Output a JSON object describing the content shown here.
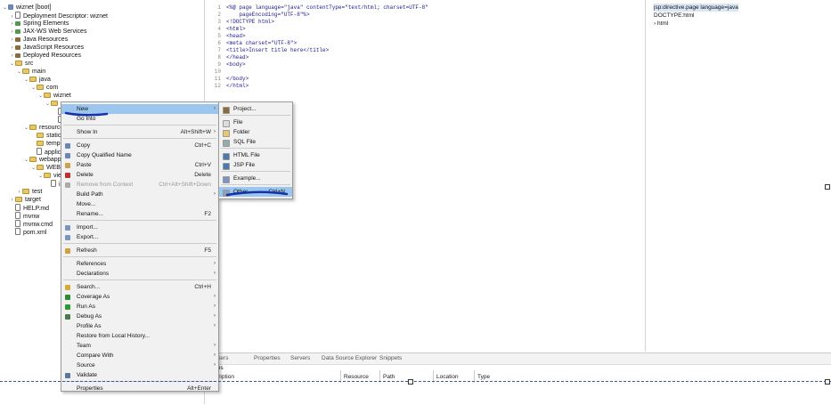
{
  "explorer": {
    "items": [
      {
        "label": "wiznet [boot]",
        "icon": "project-icon",
        "kind": "proj",
        "tw": "v"
      },
      {
        "label": "Deployment Descriptor: wiznet",
        "icon": "descriptor-icon",
        "kind": "file",
        "tw": ">"
      },
      {
        "label": "Spring Elements",
        "icon": "spring-icon",
        "kind": "ws",
        "tw": ">"
      },
      {
        "label": "JAX-WS Web Services",
        "icon": "webservice-icon",
        "kind": "ws",
        "tw": ">"
      },
      {
        "label": "Java Resources",
        "icon": "java-resources-icon",
        "kind": "lib",
        "tw": ">"
      },
      {
        "label": "JavaScript Resources",
        "icon": "javascript-resources-icon",
        "kind": "lib",
        "tw": ">"
      },
      {
        "label": "Deployed Resources",
        "icon": "deployed-resources-icon",
        "kind": "lib",
        "tw": ">"
      },
      {
        "label": "src",
        "icon": "folder-icon",
        "kind": "folder",
        "tw": "v"
      },
      {
        "label": "main",
        "icon": "folder-icon",
        "kind": "folder",
        "tw": "v"
      },
      {
        "label": "java",
        "icon": "folder-icon",
        "kind": "folder",
        "tw": "v"
      },
      {
        "label": "com",
        "icon": "folder-icon",
        "kind": "folder",
        "tw": "v"
      },
      {
        "label": "wiznet",
        "icon": "folder-icon",
        "kind": "folder",
        "tw": "v"
      },
      {
        "label": "w",
        "icon": "folder-icon",
        "kind": "folder",
        "tw": "v"
      },
      {
        "label": "",
        "icon": "file-icon",
        "kind": "file",
        "tw": ""
      },
      {
        "label": "",
        "icon": "file-icon",
        "kind": "file",
        "tw": ""
      },
      {
        "label": "resources",
        "icon": "folder-icon",
        "kind": "folder",
        "tw": "v"
      },
      {
        "label": "static",
        "icon": "folder-icon",
        "kind": "folder",
        "tw": ""
      },
      {
        "label": "templat",
        "icon": "folder-icon",
        "kind": "folder",
        "tw": ""
      },
      {
        "label": "applicat",
        "icon": "file-icon",
        "kind": "file",
        "tw": ""
      },
      {
        "label": "webapp",
        "icon": "folder-icon",
        "kind": "folder",
        "tw": "v"
      },
      {
        "label": "WEB-IN",
        "icon": "folder-icon",
        "kind": "folder",
        "tw": "v"
      },
      {
        "label": "view",
        "icon": "folder-icon",
        "kind": "folder",
        "tw": "v"
      },
      {
        "label": "in",
        "icon": "file-icon",
        "kind": "file",
        "tw": ""
      },
      {
        "label": "test",
        "icon": "folder-icon",
        "kind": "folder",
        "tw": ">"
      },
      {
        "label": "target",
        "icon": "folder-icon",
        "kind": "folder",
        "tw": ">"
      },
      {
        "label": "HELP.md",
        "icon": "file-icon",
        "kind": "file",
        "tw": ""
      },
      {
        "label": "mvnw",
        "icon": "file-icon",
        "kind": "file",
        "tw": ""
      },
      {
        "label": "mvnw.cmd",
        "icon": "file-icon",
        "kind": "file",
        "tw": ""
      },
      {
        "label": "pom.xml",
        "icon": "file-icon",
        "kind": "file",
        "tw": ""
      }
    ]
  },
  "editor": {
    "line_numbers": [
      "1",
      "2",
      "3",
      "4",
      "5",
      "6",
      "7",
      "8",
      "9",
      "10",
      "11",
      "12"
    ],
    "line_markers": [
      "⊖",
      "",
      "",
      "4⊖",
      "5⊖",
      "",
      "",
      "",
      "9⊖",
      "",
      "",
      ""
    ],
    "lines": [
      "<%@ page language=\"java\" contentType=\"text/html; charset=UTF-8\"",
      "    pageEncoding=\"UTF-8\"%>",
      "<!DOCTYPE html>",
      "<html>",
      "<head>",
      "<meta charset=\"UTF-8\">",
      "<title>Insert title here</title>",
      "</head>",
      "<body>",
      "",
      "</body>",
      "</html>"
    ]
  },
  "outline": {
    "items": [
      "jsp:directive.page language=java",
      "DOCTYPE:html",
      "html"
    ]
  },
  "bottom": {
    "tabs": [
      "rkers",
      "Properties",
      "Servers",
      "Data Source Explorer",
      "Snippets"
    ],
    "subtitle": "ms",
    "columns": [
      "cription",
      "Resource",
      "Path",
      "Location",
      "Type"
    ]
  },
  "context_menu": {
    "items": [
      {
        "label": "New",
        "shortcut": "",
        "arrow": true,
        "selected": true,
        "icon": ""
      },
      {
        "label": "Go Into",
        "shortcut": "",
        "arrow": false,
        "icon": ""
      },
      {
        "sep": true
      },
      {
        "label": "Show In",
        "shortcut": "Alt+Shift+W",
        "arrow": true,
        "icon": ""
      },
      {
        "sep": true
      },
      {
        "label": "Copy",
        "shortcut": "Ctrl+C",
        "arrow": false,
        "icon": "copy-icon"
      },
      {
        "label": "Copy Qualified Name",
        "shortcut": "",
        "arrow": false,
        "icon": "copy-qualified-icon"
      },
      {
        "label": "Paste",
        "shortcut": "Ctrl+V",
        "arrow": false,
        "icon": "paste-icon"
      },
      {
        "label": "Delete",
        "shortcut": "Delete",
        "arrow": false,
        "icon": "delete-icon"
      },
      {
        "label": "Remove from Context",
        "shortcut": "Ctrl+Alt+Shift+Down",
        "arrow": false,
        "disabled": true,
        "icon": "remove-context-icon"
      },
      {
        "label": "Build Path",
        "shortcut": "",
        "arrow": true,
        "icon": ""
      },
      {
        "label": "Move...",
        "shortcut": "",
        "arrow": false,
        "icon": ""
      },
      {
        "label": "Rename...",
        "shortcut": "F2",
        "arrow": false,
        "icon": ""
      },
      {
        "sep": true
      },
      {
        "label": "Import...",
        "shortcut": "",
        "arrow": false,
        "icon": "import-icon"
      },
      {
        "label": "Export...",
        "shortcut": "",
        "arrow": false,
        "icon": "export-icon"
      },
      {
        "sep": true
      },
      {
        "label": "Refresh",
        "shortcut": "F5",
        "arrow": false,
        "icon": "refresh-icon"
      },
      {
        "sep": true
      },
      {
        "label": "References",
        "shortcut": "",
        "arrow": true,
        "icon": ""
      },
      {
        "label": "Declarations",
        "shortcut": "",
        "arrow": true,
        "icon": ""
      },
      {
        "sep": true
      },
      {
        "label": "Search...",
        "shortcut": "Ctrl+H",
        "arrow": false,
        "icon": "search-icon"
      },
      {
        "label": "Coverage As",
        "shortcut": "",
        "arrow": true,
        "icon": "coverage-icon"
      },
      {
        "label": "Run As",
        "shortcut": "",
        "arrow": true,
        "icon": "run-icon"
      },
      {
        "label": "Debug As",
        "shortcut": "",
        "arrow": true,
        "icon": "debug-icon"
      },
      {
        "label": "Profile As",
        "shortcut": "",
        "arrow": true,
        "icon": ""
      },
      {
        "label": "Restore from Local History...",
        "shortcut": "",
        "arrow": false,
        "icon": ""
      },
      {
        "label": "Team",
        "shortcut": "",
        "arrow": true,
        "icon": ""
      },
      {
        "label": "Compare With",
        "shortcut": "",
        "arrow": true,
        "icon": ""
      },
      {
        "label": "Source",
        "shortcut": "",
        "arrow": true,
        "icon": ""
      },
      {
        "label": "Validate",
        "shortcut": "",
        "arrow": false,
        "icon": "validate-icon"
      },
      {
        "sep": true
      },
      {
        "label": "Properties",
        "shortcut": "Alt+Enter",
        "arrow": false,
        "icon": ""
      }
    ]
  },
  "submenu": {
    "items": [
      {
        "label": "Project...",
        "shortcut": "",
        "icon": "project-new-icon"
      },
      {
        "sep": true
      },
      {
        "label": "File",
        "shortcut": "",
        "icon": "file-new-icon"
      },
      {
        "label": "Folder",
        "shortcut": "",
        "icon": "folder-new-icon"
      },
      {
        "label": "SQL File",
        "shortcut": "",
        "icon": "sql-file-icon"
      },
      {
        "sep": true
      },
      {
        "label": "HTML File",
        "shortcut": "",
        "icon": "html-file-icon"
      },
      {
        "label": "JSP File",
        "shortcut": "",
        "icon": "jsp-file-icon"
      },
      {
        "sep": true
      },
      {
        "label": "Example...",
        "shortcut": "",
        "icon": "example-icon"
      },
      {
        "sep": true
      },
      {
        "label": "Other...",
        "shortcut": "Ctrl+N",
        "icon": "other-icon",
        "selected": true
      }
    ]
  }
}
